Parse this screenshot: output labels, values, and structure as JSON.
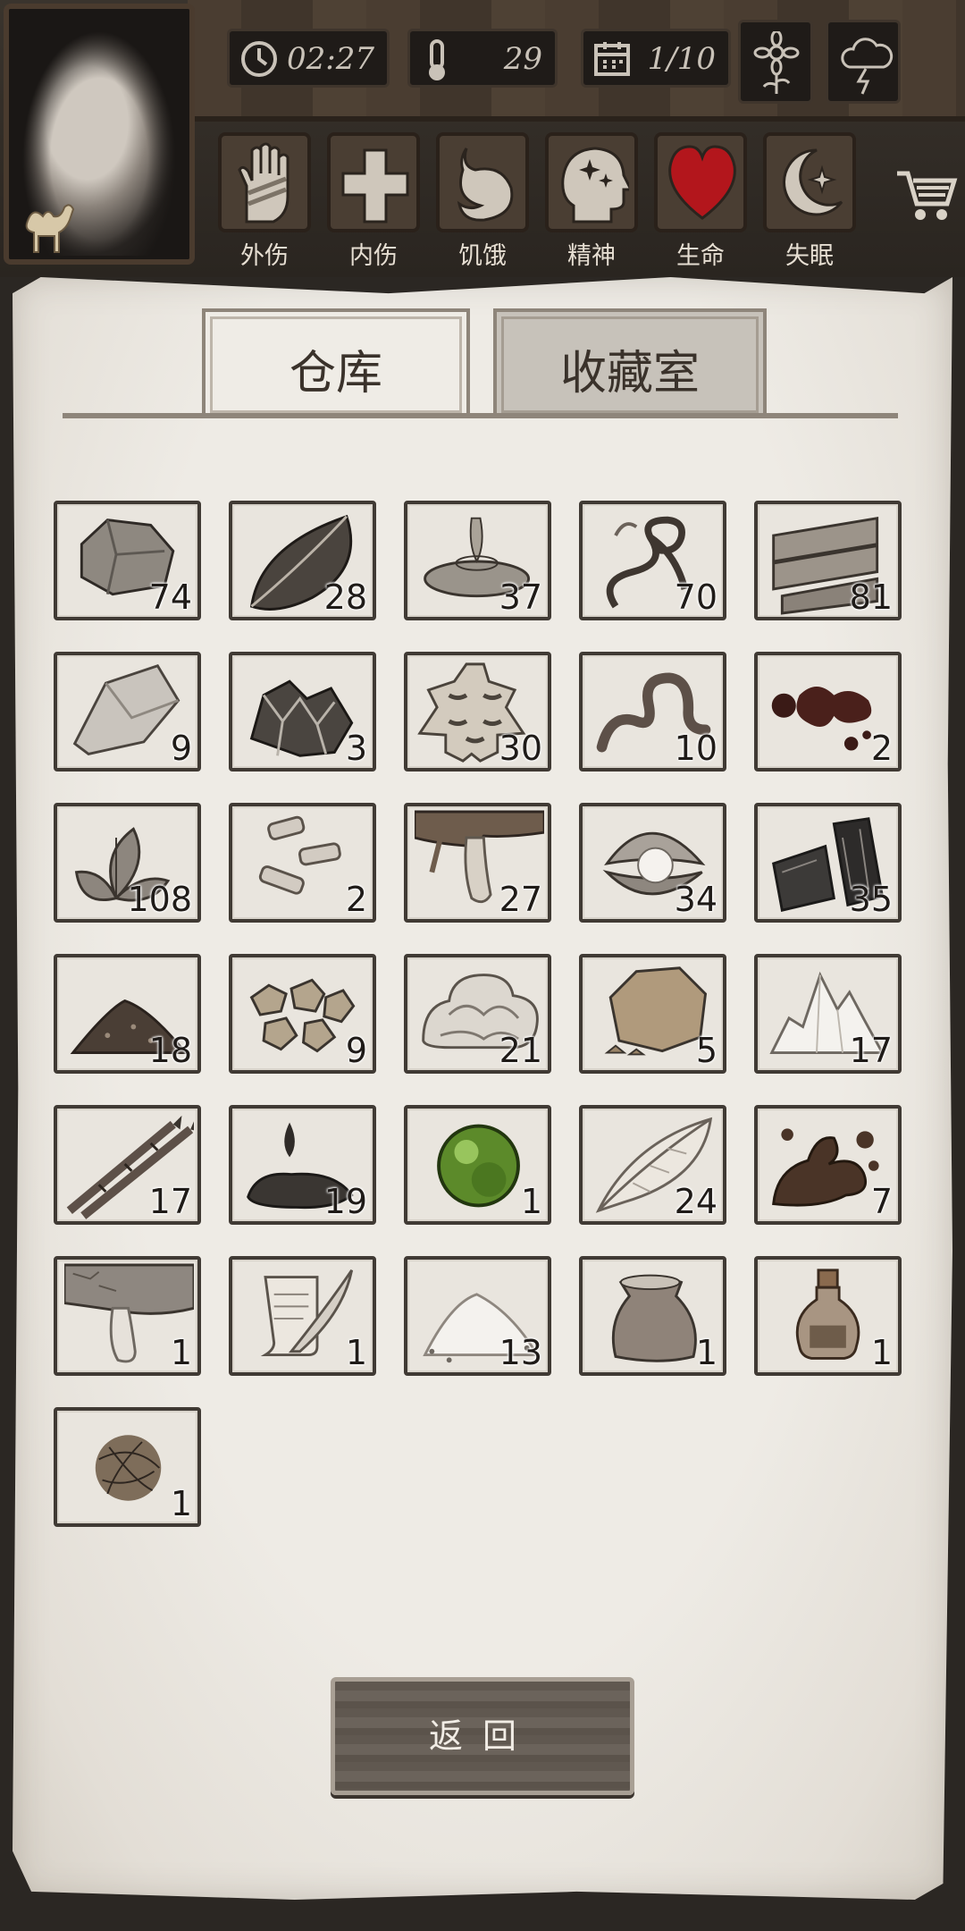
{
  "hud": {
    "time": "02:27",
    "temperature": "29",
    "day": "1/10",
    "icons": {
      "time": "clock-icon",
      "temperature": "thermometer-icon",
      "day": "calendar-icon",
      "flower": "flower-icon",
      "weather": "storm-cloud-icon"
    }
  },
  "status": [
    {
      "label": "外伤",
      "icon": "bandaged-hand-icon"
    },
    {
      "label": "内伤",
      "icon": "cross-icon"
    },
    {
      "label": "饥饿",
      "icon": "stomach-icon"
    },
    {
      "label": "精神",
      "icon": "head-sparkle-icon"
    },
    {
      "label": "生命",
      "icon": "heart-icon"
    },
    {
      "label": "失眠",
      "icon": "moon-star-icon"
    }
  ],
  "tabs": {
    "warehouse": "仓库",
    "collection": "收藏室"
  },
  "items": [
    {
      "icon": "stone-icon",
      "count": "74"
    },
    {
      "icon": "leaf-icon",
      "count": "28"
    },
    {
      "icon": "water-puddle-icon",
      "count": "37"
    },
    {
      "icon": "vine-icon",
      "count": "70"
    },
    {
      "icon": "wood-planks-icon",
      "count": "81"
    },
    {
      "icon": "flint-icon",
      "count": "9"
    },
    {
      "icon": "ore-crystal-icon",
      "count": "3"
    },
    {
      "icon": "animal-hide-icon",
      "count": "30"
    },
    {
      "icon": "worm-icon",
      "count": "10"
    },
    {
      "icon": "blood-drops-icon",
      "count": "2"
    },
    {
      "icon": "herb-icon",
      "count": "108"
    },
    {
      "icon": "bone-shards-icon",
      "count": "2"
    },
    {
      "icon": "tree-resin-icon",
      "count": "27"
    },
    {
      "icon": "pearl-icon",
      "count": "34"
    },
    {
      "icon": "charcoal-icon",
      "count": "35"
    },
    {
      "icon": "soil-pile-icon",
      "count": "18"
    },
    {
      "icon": "gold-nuggets-icon",
      "count": "9"
    },
    {
      "icon": "cotton-icon",
      "count": "21"
    },
    {
      "icon": "sandstone-icon",
      "count": "5"
    },
    {
      "icon": "salt-crystal-icon",
      "count": "17"
    },
    {
      "icon": "bamboo-spears-icon",
      "count": "17"
    },
    {
      "icon": "oil-drop-icon",
      "count": "19"
    },
    {
      "icon": "green-orb-icon",
      "count": "1"
    },
    {
      "icon": "feather-icon",
      "count": "24"
    },
    {
      "icon": "mud-splash-icon",
      "count": "7"
    },
    {
      "icon": "fish-oil-icon",
      "count": "1"
    },
    {
      "icon": "scroll-quill-icon",
      "count": "1"
    },
    {
      "icon": "flour-pile-icon",
      "count": "13"
    },
    {
      "icon": "grain-sack-icon",
      "count": "1"
    },
    {
      "icon": "potion-bottle-icon",
      "count": "1"
    },
    {
      "icon": "hairball-icon",
      "count": "1"
    }
  ],
  "back_button": "返回",
  "colors": {
    "heart": "#b3161c",
    "paper": "#eeebe5",
    "frame": "#403a34"
  }
}
